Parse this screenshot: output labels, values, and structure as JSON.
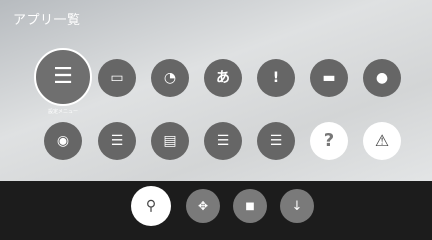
{
  "header": {
    "title": "アプリ一覧"
  },
  "apps": [
    {
      "label": "設定メニュー",
      "icon": "settings-menu-icon",
      "glyph": "☰"
    },
    {
      "label": "",
      "icon": "screen-mirroring-icon",
      "glyph": "▭"
    },
    {
      "label": "",
      "icon": "clock-icon",
      "glyph": "◔"
    },
    {
      "label": "",
      "icon": "language-icon",
      "glyph": "あ"
    },
    {
      "label": "",
      "icon": "alert-icon",
      "glyph": "!"
    },
    {
      "label": "",
      "icon": "projector-icon",
      "glyph": "▬"
    },
    {
      "label": "",
      "icon": "user-icon",
      "glyph": "●"
    },
    {
      "label": "",
      "icon": "media-search-icon",
      "glyph": "◉"
    },
    {
      "label": "",
      "icon": "schedule-list-icon",
      "glyph": "☰"
    },
    {
      "label": "",
      "icon": "memory-card-icon",
      "glyph": "▤"
    },
    {
      "label": "",
      "icon": "list-timer-icon",
      "glyph": "☰"
    },
    {
      "label": "",
      "icon": "list-detail-icon",
      "glyph": "☰"
    },
    {
      "label": "",
      "icon": "help-icon",
      "glyph": "?"
    },
    {
      "label": "",
      "icon": "warning-icon",
      "glyph": "⚠"
    }
  ],
  "dock": [
    {
      "label": "",
      "icon": "pin-icon",
      "glyph": "⚲"
    },
    {
      "label": "",
      "icon": "move-icon",
      "glyph": "✥"
    },
    {
      "label": "",
      "icon": "lock-icon",
      "glyph": "■"
    },
    {
      "label": "",
      "icon": "download-icon",
      "glyph": "↓"
    }
  ]
}
